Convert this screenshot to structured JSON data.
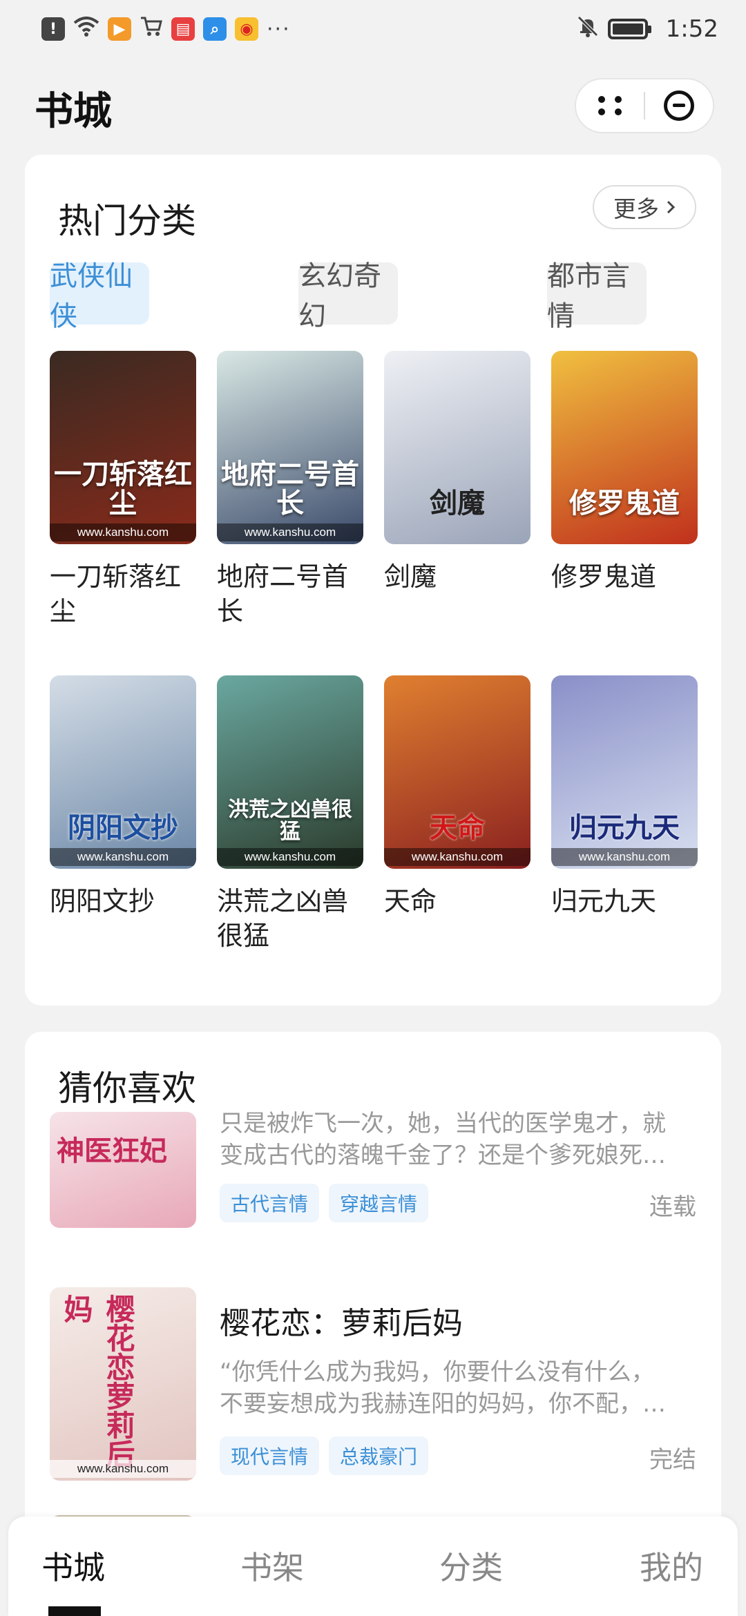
{
  "status_bar": {
    "time": "1:52",
    "left_icons": [
      "alert-icon",
      "wifi-icon",
      "video-app-icon",
      "shopping-cart-icon",
      "reader-app-icon",
      "search-app-icon",
      "weibo-icon"
    ],
    "more": "···"
  },
  "header": {
    "title": "书城"
  },
  "hot": {
    "title": "热门分类",
    "more_label": "更多",
    "tabs": [
      {
        "label": "武侠仙侠",
        "active": true
      },
      {
        "label": "玄幻奇幻",
        "active": false
      },
      {
        "label": "都市言情",
        "active": false
      }
    ],
    "books": [
      {
        "name": "一刀斩落红尘",
        "cover_text": "一刀斩落红尘",
        "site": "www.kanshu.com",
        "colors": [
          "#3a2a22",
          "#8a2a1a"
        ]
      },
      {
        "name": "地府二号首长",
        "cover_text": "地府二号首长",
        "site": "www.kanshu.com",
        "colors": [
          "#d9e8e4",
          "#3a4a6a"
        ]
      },
      {
        "name": "剑魔",
        "cover_text": "剑魔",
        "site": "",
        "colors": [
          "#eef0f4",
          "#9aa4b8"
        ]
      },
      {
        "name": "修罗鬼道",
        "cover_text": "修罗鬼道",
        "site": "",
        "colors": [
          "#f0c040",
          "#c0301c"
        ]
      },
      {
        "name": "阴阳文抄",
        "cover_text": "阴阳文抄",
        "site": "www.kanshu.com",
        "colors": [
          "#d4dde6",
          "#6a86a6"
        ]
      },
      {
        "name": "洪荒之凶兽很猛",
        "cover_text": "洪荒之凶兽很猛",
        "site": "www.kanshu.com",
        "colors": [
          "#6aa8a0",
          "#2a3a2a"
        ]
      },
      {
        "name": "天命",
        "cover_text": "天命",
        "site": "www.kanshu.com",
        "colors": [
          "#e08030",
          "#8a2020"
        ]
      },
      {
        "name": "归元九天",
        "cover_text": "归元九天",
        "site": "www.kanshu.com",
        "colors": [
          "#8a90c8",
          "#d8e0f0"
        ]
      }
    ]
  },
  "guess": {
    "title": "猜你喜欢",
    "items": [
      {
        "title": "",
        "cover_text": "神医狂妃",
        "site": "",
        "colors": [
          "#f6e3e8",
          "#e8a8b8"
        ],
        "desc_line1": "只是被炸飞一次，她，当代的医学鬼才，就",
        "desc_line2": "变成古代的落魄千金了？还是个爹死娘死…",
        "tags": [
          "古代言情",
          "穿越言情"
        ],
        "status": "连载"
      },
      {
        "title": "樱花恋：萝莉后妈",
        "cover_text": "樱花恋萝莉后妈",
        "site": "www.kanshu.com",
        "colors": [
          "#f5ece8",
          "#e2c4c0"
        ],
        "desc_line1": "“你凭什么成为我妈，你要什么没有什么，",
        "desc_line2": "不要妄想成为我赫连阳的妈妈，你不配，…",
        "tags": [
          "现代言情",
          "总裁豪门"
        ],
        "status": "完结"
      }
    ]
  },
  "bottom_nav": {
    "items": [
      {
        "label": "书城",
        "active": true
      },
      {
        "label": "书架",
        "active": false
      },
      {
        "label": "分类",
        "active": false
      },
      {
        "label": "我的",
        "active": false
      }
    ]
  }
}
